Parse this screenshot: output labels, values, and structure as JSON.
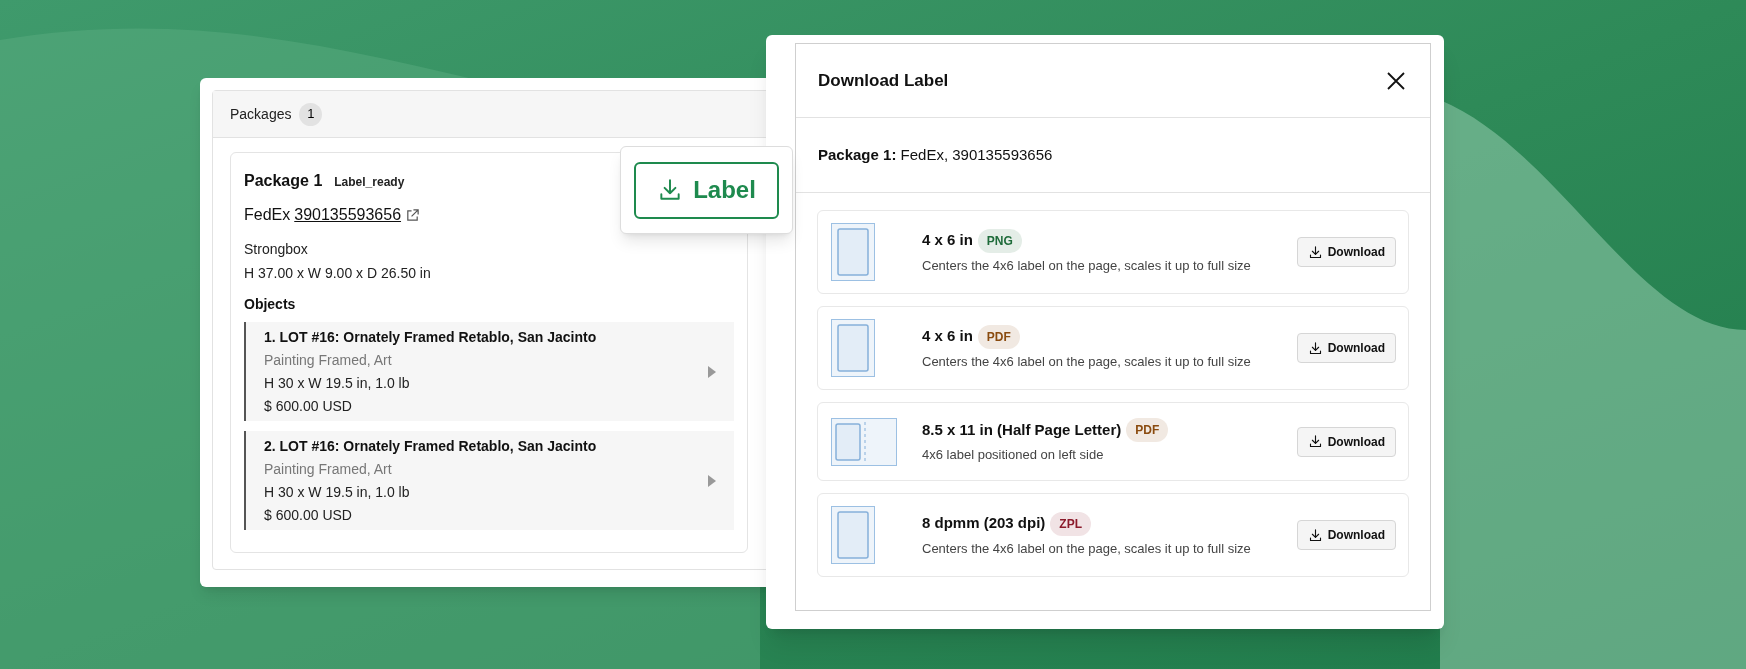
{
  "packages_panel": {
    "title": "Packages",
    "count": "1",
    "package": {
      "name": "Package 1",
      "status": "Label_ready",
      "carrier": "FedEx",
      "tracking": "390135593656",
      "box": "Strongbox",
      "dimensions": "H 37.00 x W 9.00 x D 26.50 in",
      "objects_heading": "Objects",
      "objects": [
        {
          "title": "1. LOT #16: Ornately Framed Retablo, San Jacinto",
          "category": "Painting Framed, Art",
          "size": "H 30 x W 19.5 in, 1.0 lb",
          "price": "$ 600.00 USD"
        },
        {
          "title": "2. LOT #16: Ornately Framed Retablo, San Jacinto",
          "category": "Painting Framed, Art",
          "size": "H 30 x W 19.5 in, 1.0 lb",
          "price": "$ 600.00 USD"
        }
      ]
    }
  },
  "label_button": {
    "label": "Label"
  },
  "dialog": {
    "title": "Download Label",
    "package_line": "**Package 1:** FedEx, 390135593656",
    "options": [
      {
        "kind": "portrait",
        "title": "4 x 6 in",
        "format": "PNG",
        "color": "#1e6b3a",
        "description": "Centers the 4x6 label on the page, scales it up to full size",
        "button": "Download"
      },
      {
        "kind": "portrait",
        "title": "4 x 6 in",
        "format": "PDF",
        "color": "#8a4b0f",
        "description": "Centers the 4x6 label on the page, scales it up to full size",
        "button": "Download"
      },
      {
        "kind": "half_page",
        "title": "8.5 x 11 in (Half Page Letter)",
        "format": "PDF",
        "color": "#8a4b0f",
        "description": "4x6 label positioned on left side",
        "button": "Download"
      },
      {
        "kind": "portrait",
        "title": "8 dpmm (203 dpi)",
        "format": "ZPL",
        "color": "#8b1a2b",
        "description": "Centers the 4x6 label on the page, scales it up to full size",
        "button": "Download"
      }
    ]
  }
}
